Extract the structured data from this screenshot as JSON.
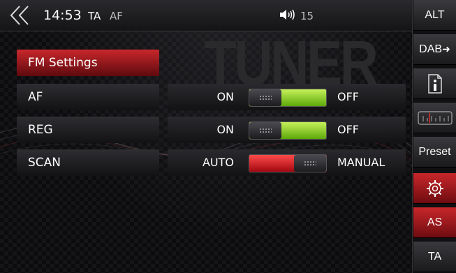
{
  "status": {
    "time": "14:53",
    "ta": "TA",
    "af": "AF",
    "volume": "15"
  },
  "watermark": "TUNER",
  "sidebar": {
    "alt": "ALT",
    "dab": "DAB",
    "preset": "Preset",
    "as": "AS",
    "ta": "TA"
  },
  "section_title": "FM Settings",
  "rows": [
    {
      "label": "AF",
      "left": "ON",
      "right": "OFF",
      "state": "ON"
    },
    {
      "label": "REG",
      "left": "ON",
      "right": "OFF",
      "state": "ON"
    },
    {
      "label": "SCAN",
      "left": "AUTO",
      "right": "MANUAL",
      "state": "AUTO"
    }
  ],
  "colors": {
    "accent_red": "#c8272b",
    "toggle_green": "#8cd234"
  }
}
